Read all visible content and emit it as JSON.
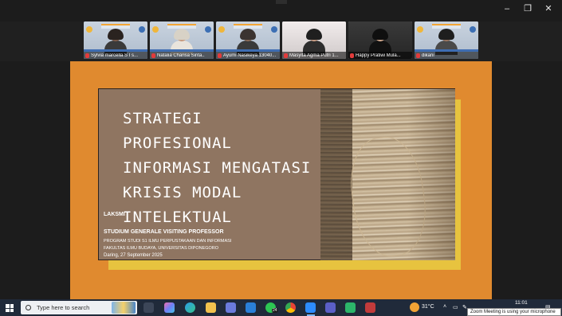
{
  "window": {
    "minimize_glyph": "–",
    "restore_glyph": "❐",
    "close_glyph": "✕"
  },
  "participants": [
    {
      "name": "Sylvia marcella S I s...",
      "type": "avatar-bg"
    },
    {
      "name": "Natalia Charisa Sinta..",
      "type": "avatar-bg"
    },
    {
      "name": "Ayumi Nasikeya 13040...",
      "type": "avatar-bg"
    },
    {
      "name": "Masyita Agma Putri 1...",
      "type": "cam"
    },
    {
      "name": "Happy Pratiwi Mula...",
      "type": "cam"
    },
    {
      "name": "dikarii",
      "type": "avatar-bg"
    }
  ],
  "slide": {
    "title_lines": [
      "STRATEGI PROFESIONAL",
      "INFORMASI MENGATASI",
      "KRISIS MODAL",
      "INTELEKTUAL"
    ],
    "author": "LAKSMI",
    "event": "STUDIUM GENERALE VISITING PROFESSOR",
    "program": "PROGRAM STUDI S1 ILMU PERPUSTAKAAN DAN INFORMASI",
    "faculty": "FAKULTAS ILMU BUDAYA, UNIVERSITAS DIPONEGORO",
    "date": "Daring, 27 September 2025"
  },
  "taskbar": {
    "search_placeholder": "Type here to search",
    "whatsapp_badge": "24",
    "temperature": "31°C",
    "time": "11:01",
    "notification": "Zoom Meeting is using your microphone"
  },
  "colors": {
    "stage": "#e08a2f",
    "slide_bg": "#8f7561",
    "slide_shadow": "#e7c33f",
    "taskbar": "#202a3a"
  }
}
